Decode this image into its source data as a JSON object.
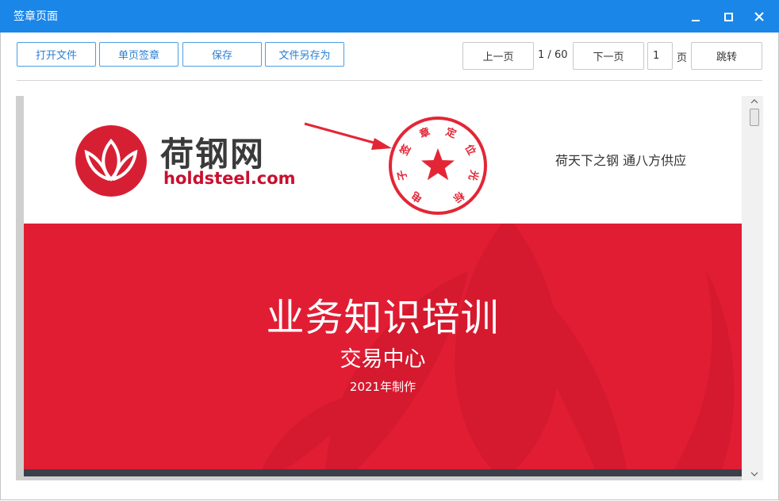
{
  "window": {
    "title": "签章页面"
  },
  "toolbar": {
    "open_file": "打开文件",
    "single_page_sign": "单页签章",
    "save": "保存",
    "save_as": "文件另存为"
  },
  "nav": {
    "prev": "上一页",
    "current_page": "1",
    "separator": "/",
    "total_pages": "60",
    "next": "下一页",
    "page_input_value": "1",
    "page_unit": "页",
    "jump": "跳转"
  },
  "document": {
    "logo_cn": "荷钢网",
    "logo_en": "holdsteel.com",
    "stamp_text": "电子签章定位光标",
    "slogan": "荷天下之钢  通八方供应",
    "title": "业务知识培训",
    "subtitle": "交易中心",
    "year": "2021年制作"
  },
  "colors": {
    "titlebar": "#1a86e8",
    "accent": "#2b7fd1",
    "brand_red": "#e11d34",
    "stamp_red": "#e32636"
  }
}
